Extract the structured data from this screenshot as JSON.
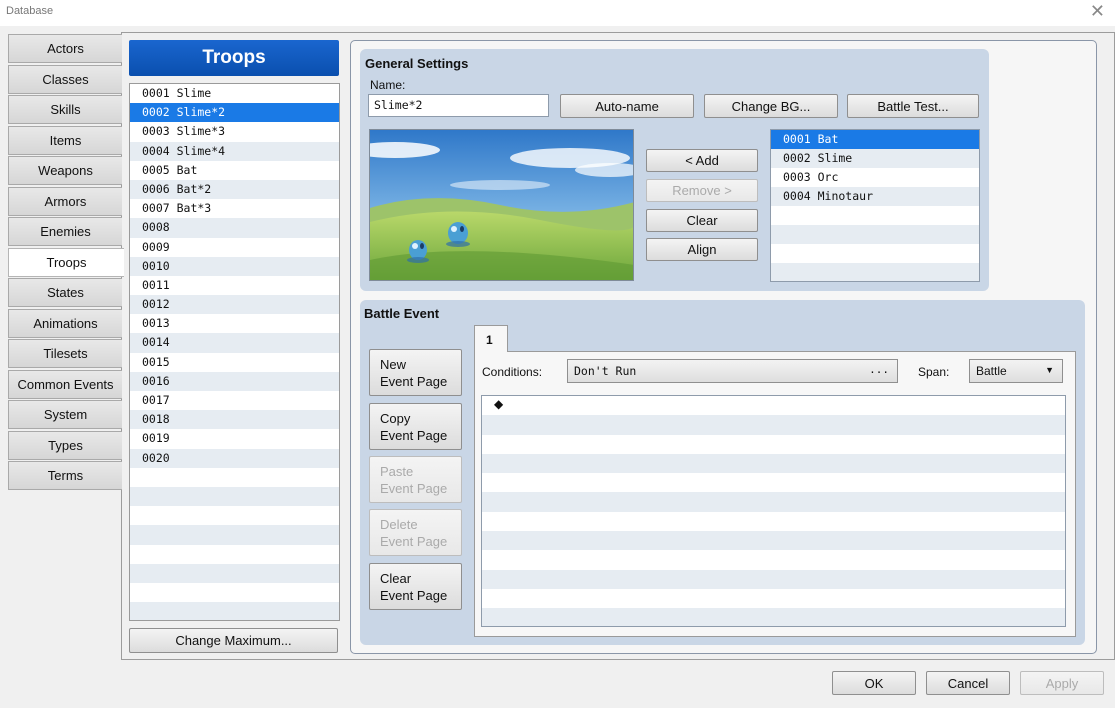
{
  "window": {
    "title": "Database",
    "close_symbol": "✕"
  },
  "categories": [
    "Actors",
    "Classes",
    "Skills",
    "Items",
    "Weapons",
    "Armors",
    "Enemies",
    "Troops",
    "States",
    "Animations",
    "Tilesets",
    "Common Events",
    "System",
    "Types",
    "Terms"
  ],
  "active_category": "Troops",
  "troops": {
    "header": "Troops",
    "items": [
      "0001 Slime",
      "0002 Slime*2",
      "0003 Slime*3",
      "0004 Slime*4",
      "0005 Bat",
      "0006 Bat*2",
      "0007 Bat*3",
      "0008",
      "0009",
      "0010",
      "0011",
      "0012",
      "0013",
      "0014",
      "0015",
      "0016",
      "0017",
      "0018",
      "0019",
      "0020",
      "",
      "",
      "",
      "",
      "",
      "",
      "",
      ""
    ],
    "selected_index": 1,
    "change_max_label": "Change Maximum..."
  },
  "general": {
    "title": "General Settings",
    "name_label": "Name:",
    "name_value": "Slime*2",
    "auto_name": "Auto-name",
    "change_bg": "Change BG...",
    "battle_test": "Battle Test...",
    "add": "< Add",
    "remove": "Remove >",
    "clear": "Clear",
    "align": "Align",
    "enemies": [
      "0001 Bat",
      "0002 Slime",
      "0003 Orc",
      "0004 Minotaur",
      "",
      "",
      "",
      ""
    ],
    "selected_enemy_index": 0
  },
  "battle_event": {
    "title": "Battle Event",
    "buttons": [
      {
        "label": "New\nEvent Page",
        "enabled": true
      },
      {
        "label": "Copy\nEvent Page",
        "enabled": true
      },
      {
        "label": "Paste\nEvent Page",
        "enabled": false
      },
      {
        "label": "Delete\nEvent Page",
        "enabled": false
      },
      {
        "label": "Clear\nEvent Page",
        "enabled": true
      }
    ],
    "page_tab": "1",
    "conditions_label": "Conditions:",
    "conditions_value": "Don't Run",
    "conditions_button": "...",
    "span_label": "Span:",
    "span_value": "Battle",
    "command_marker": "◆",
    "row_count": 12
  },
  "footer": {
    "ok": "OK",
    "cancel": "Cancel",
    "apply": "Apply"
  },
  "colors": {
    "selection": "#1a7ae6",
    "header_blue": "#0a4fae",
    "panel": "#c9d6e6"
  }
}
